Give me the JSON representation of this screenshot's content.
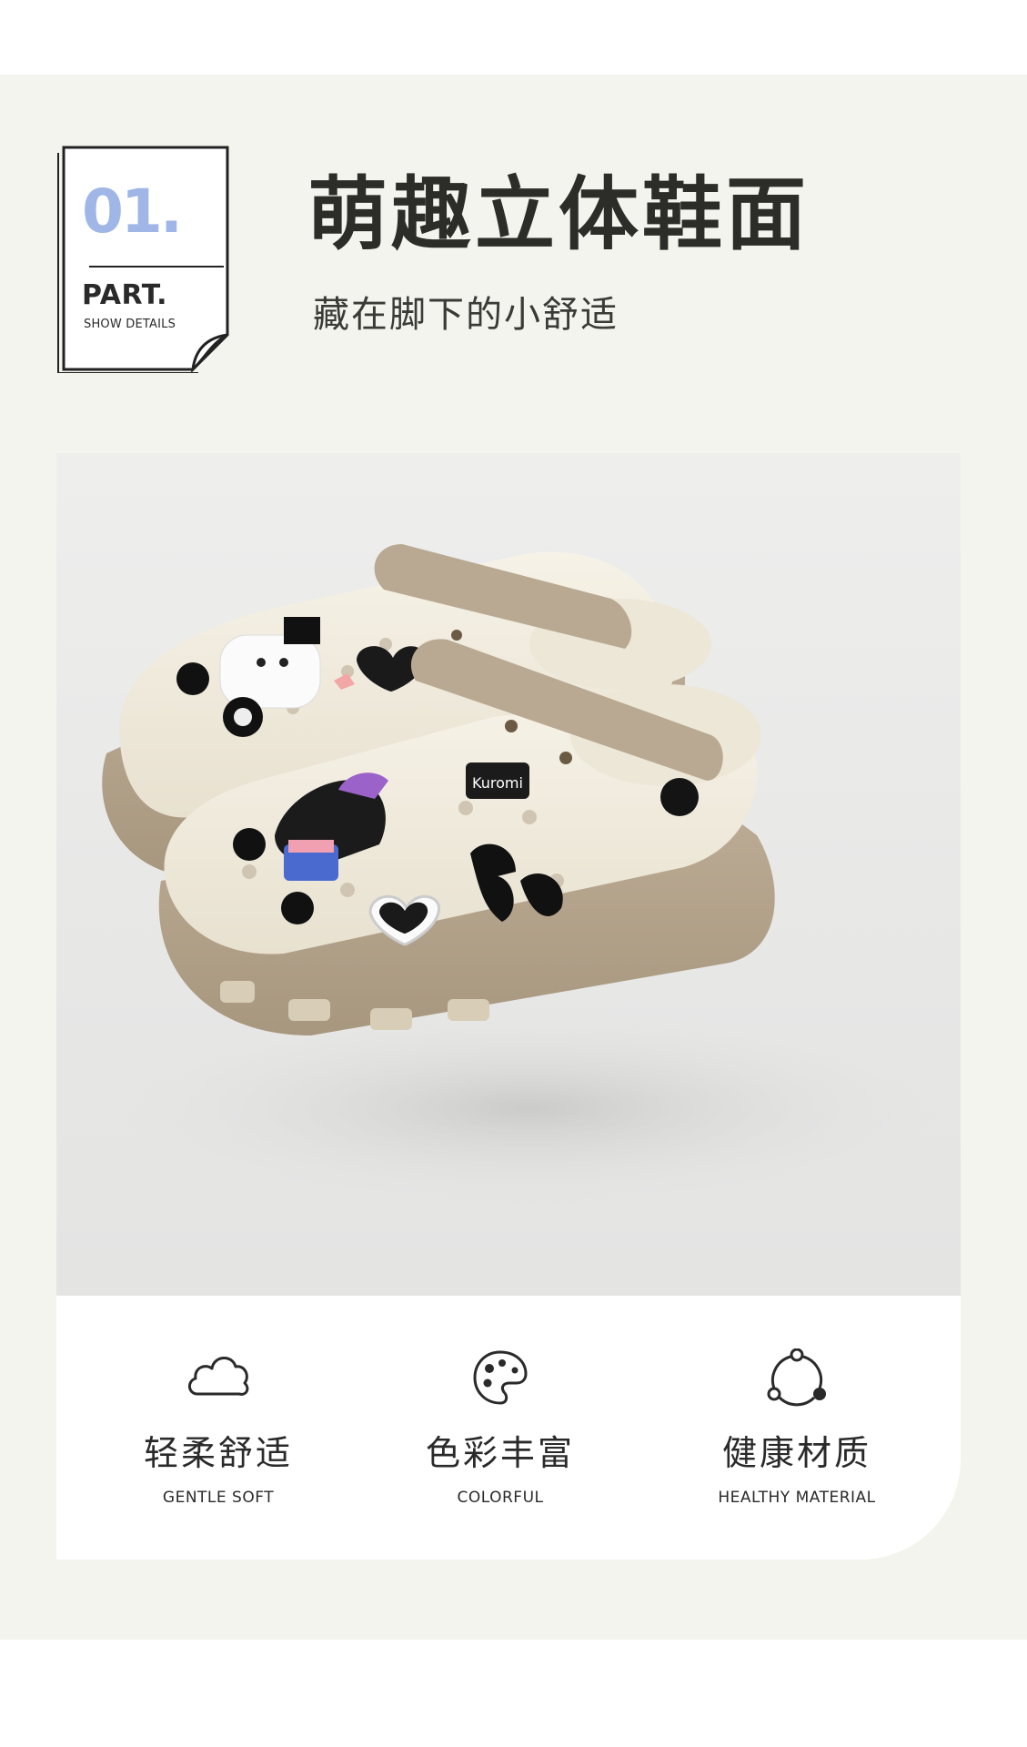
{
  "badge": {
    "number": "01.",
    "part": "PART.",
    "sub": "SHOW DETAILS",
    "number_color": "#9fb6e6"
  },
  "header": {
    "title": "萌趣立体鞋面",
    "subtitle": "藏在脚下的小舒适"
  },
  "product": {
    "charm_text": "Kuromi",
    "upper_color": "#f1ece0",
    "sole_color": "#b4a48e"
  },
  "features": [
    {
      "icon": "cloud-icon",
      "title_cn": "轻柔舒适",
      "title_en": "GENTLE SOFT"
    },
    {
      "icon": "palette-icon",
      "title_cn": "色彩丰富",
      "title_en": "COLORFUL"
    },
    {
      "icon": "cycle-icon",
      "title_cn": "健康材质",
      "title_en": "HEALTHY MATERIAL"
    }
  ]
}
